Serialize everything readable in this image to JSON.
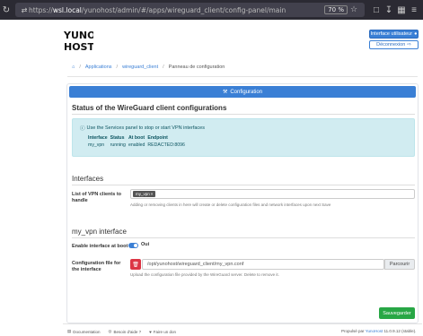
{
  "browser": {
    "url_prefix": "https://",
    "url_host": "wsl.local",
    "url_path": "/yunohost/admin/#/apps/wireguard_client/config-panel/main",
    "zoom": "70 %"
  },
  "header": {
    "logo_text": "YUNOHOST",
    "user_button": "Interface utilisateur",
    "logout_button": "Déconnexion"
  },
  "breadcrumb": {
    "apps": "Applications",
    "app": "wireguard_client",
    "current": "Panneau de configuration"
  },
  "tab": {
    "label": "Configuration"
  },
  "status": {
    "title": "Status of the WireGuard client configurations",
    "message": "Use the Services panel to stop or start VPN interfaces",
    "columns": [
      "Interface",
      "Status",
      "At boot",
      "Endpoint"
    ],
    "rows": [
      [
        "my_vpn",
        "running",
        "enabled",
        "REDACTED:8096"
      ]
    ]
  },
  "interfaces": {
    "title": "Interfaces",
    "label": "List of VPN clients to handle",
    "tag": "my_vpn",
    "help": "Adding or removing clients in here will create or delete configuration files and network interfaces upon next Save"
  },
  "my_vpn": {
    "title": "my_vpn interface",
    "boot_label": "Enable interface at boot",
    "boot_value": "Oui",
    "file_label": "Configuration file for the interface",
    "file_value": "/opt/yunohost/wireguard_client/my_vpn.conf",
    "browse": "Parcourir",
    "file_help": "Upload the configuration file provided by the WireGuard server. Delete to remove it."
  },
  "save_button": "Sauvegarder",
  "footer": {
    "documentation": "Documentation",
    "help": "Besoin d'aide ?",
    "donate": "Faire un don",
    "powered_prefix": "Propulsé par",
    "powered_name": "YunoHost",
    "version": "11.0.9.12 (stable)."
  },
  "colors": {
    "primary": "#3a7fd5",
    "success": "#28a745",
    "danger": "#dc3545",
    "info_bg": "#d1ecf1"
  }
}
